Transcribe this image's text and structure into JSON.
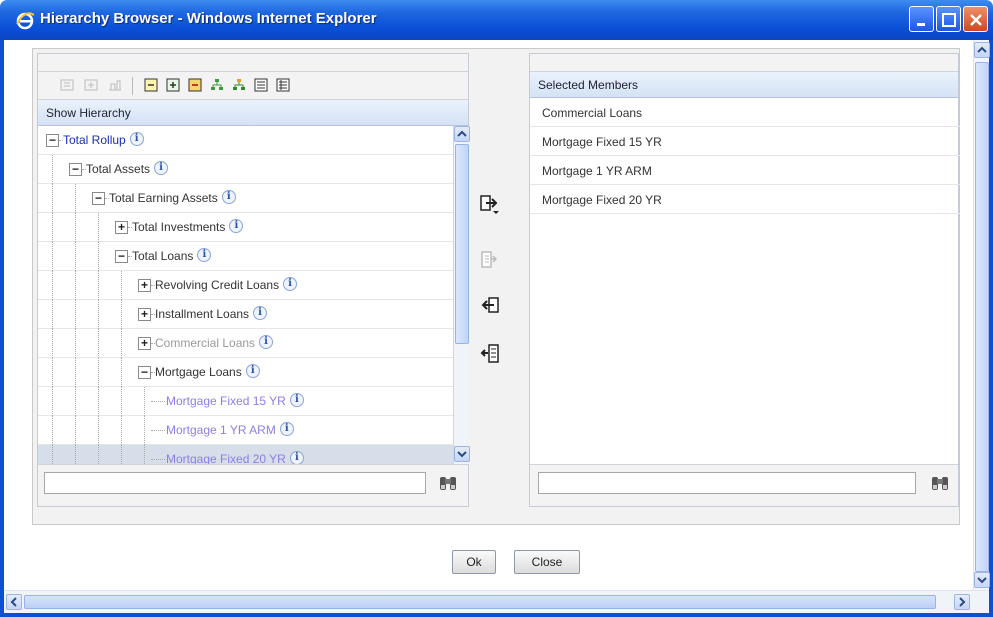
{
  "window": {
    "title": "Hierarchy Browser - Windows Internet Explorer"
  },
  "left_panel": {
    "header": "Show Hierarchy",
    "toolbar_icons": [
      "collapse-all-icon",
      "expand-all-icon",
      "level-icon",
      "collapse-icon",
      "expand-icon",
      "focus-icon",
      "tree-icon",
      "tree-color-icon",
      "list-icon",
      "list-detail-icon"
    ],
    "tree": [
      {
        "label": "Total Rollup",
        "level": 0,
        "toggle": "-",
        "style": "blue"
      },
      {
        "label": "Total Assets",
        "level": 1,
        "toggle": "-",
        "style": "dark"
      },
      {
        "label": "Total Earning Assets",
        "level": 2,
        "toggle": "-",
        "style": "dark"
      },
      {
        "label": "Total Investments",
        "level": 3,
        "toggle": "+",
        "style": "dark"
      },
      {
        "label": "Total Loans",
        "level": 3,
        "toggle": "-",
        "style": "dark"
      },
      {
        "label": "Revolving Credit Loans",
        "level": 4,
        "toggle": "+",
        "style": "dark"
      },
      {
        "label": "Installment Loans",
        "level": 4,
        "toggle": "+",
        "style": "dark"
      },
      {
        "label": "Commercial Loans",
        "level": 4,
        "toggle": "+",
        "style": "gray"
      },
      {
        "label": "Mortgage Loans",
        "level": 4,
        "toggle": "-",
        "style": "dark"
      },
      {
        "label": "Mortgage Fixed 15 YR",
        "level": 5,
        "toggle": "",
        "style": "leaf"
      },
      {
        "label": "Mortgage 1 YR ARM",
        "level": 5,
        "toggle": "",
        "style": "leaf"
      },
      {
        "label": "Mortgage Fixed 20 YR",
        "level": 5,
        "toggle": "",
        "style": "leaf",
        "selected": true
      }
    ],
    "search_value": ""
  },
  "right_panel": {
    "header": "Selected Members",
    "items": [
      "Commercial Loans",
      "Mortgage Fixed 15 YR",
      "Mortgage 1 YR ARM",
      "Mortgage Fixed 20 YR"
    ],
    "search_value": ""
  },
  "transfer_buttons": [
    "select-icon",
    "select-disabled-icon",
    "deselect-icon",
    "deselect-all-icon"
  ],
  "buttons": {
    "ok": "Ok",
    "close": "Close"
  },
  "colors": {
    "titlebar": "#0a50d8",
    "selected_row": "#d6dee9",
    "link_blue": "#1a2fb3",
    "leaf_purple": "#8a80e6"
  }
}
